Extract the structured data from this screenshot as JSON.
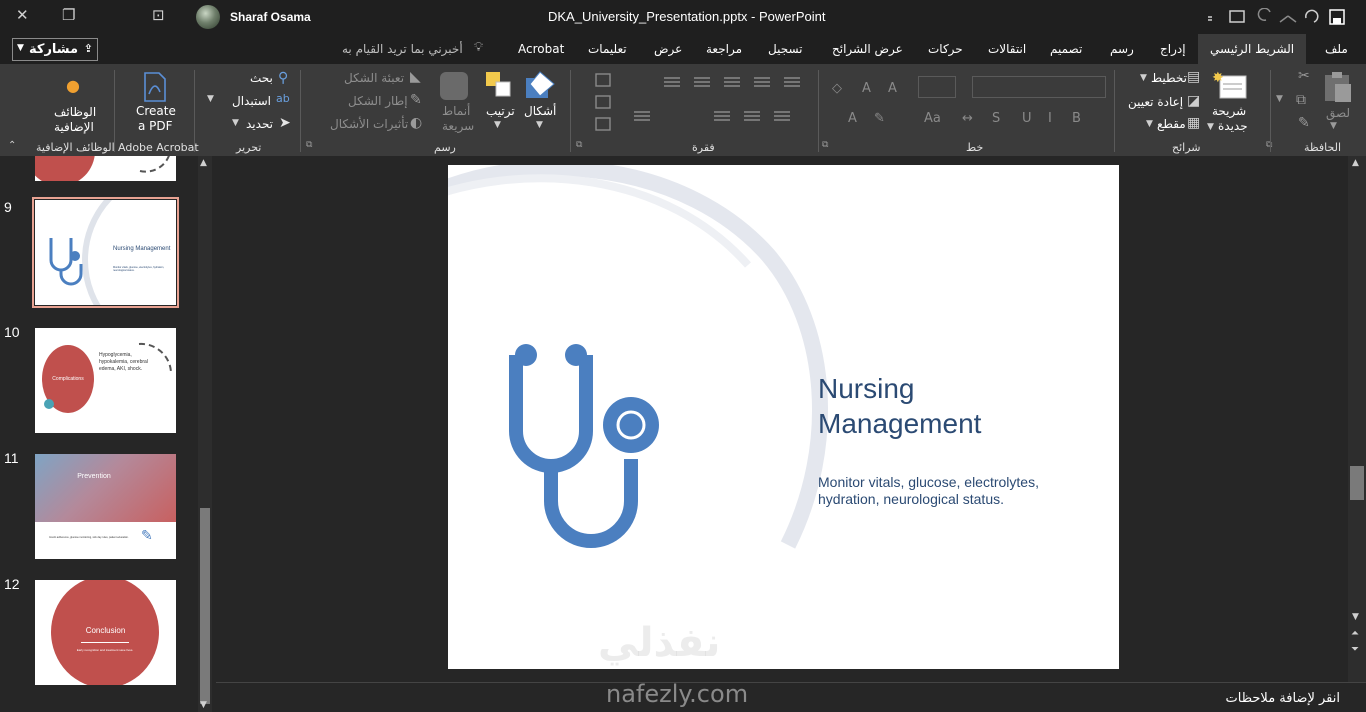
{
  "window": {
    "close_glyph": "✕",
    "restore_glyph": "❐",
    "ribbon_display_glyph": "⊡",
    "user_name": "Sharaf Osama",
    "doc_title": "DKA_University_Presentation.pptx  -  PowerPoint"
  },
  "header": {
    "share_label": "مشاركة",
    "tell_me": "أخبرني بما تريد القيام به",
    "tabs": [
      "ملف",
      "الشريط الرئيسي",
      "إدراج",
      "رسم",
      "تصميم",
      "انتقالات",
      "حركات",
      "عرض الشرائح",
      "تسجيل",
      "مراجعة",
      "عرض",
      "تعليمات",
      "Acrobat"
    ],
    "active_tab": "الشريط الرئيسي"
  },
  "ribbon": {
    "groups": {
      "addins": "الوظائف الإضافية",
      "acrobat": "Adobe Acrobat",
      "editing": "تحرير",
      "drawing": "رسم",
      "paragraph": "فقرة",
      "font": "خط",
      "slides": "شرائح",
      "clipboard": "الحافظة"
    },
    "addins_btn_1": "الوظائف",
    "addins_btn_2": "الإضافية",
    "create_pdf_1": "Create",
    "create_pdf_2": "a PDF",
    "find": "بحث",
    "replace": "استبدال",
    "select": "تحديد",
    "shape_fill": "تعبئة الشكل",
    "shape_outline": "إطار الشكل",
    "shape_effects": "تأثيرات الأشكال",
    "quick_styles_1": "أنماط",
    "quick_styles_2": "سريعة",
    "arrange": "ترتيب",
    "shapes": "أشكال",
    "layout": "تخطيط",
    "reset": "إعادة تعيين",
    "section": "مقطع",
    "new_slide_1": "شريحة",
    "new_slide_2": "جديدة",
    "paste": "لصق"
  },
  "thumbnails": [
    {
      "num": "9",
      "title": "Nursing Management",
      "text": "Monitor vitals, glucose, electrolytes, hydration, neurological status."
    },
    {
      "num": "10",
      "title": "Complications",
      "text": "Hypoglycemia, hypokalemia, cerebral edema, AKI, shock."
    },
    {
      "num": "11",
      "title": "Prevention",
      "text": "Insulin adherence, glucose monitoring, sick day rules, patient education."
    },
    {
      "num": "12",
      "title": "Conclusion",
      "text": "Early recognition and treatment save lives."
    }
  ],
  "slide": {
    "title": "Nursing Management",
    "body": "Monitor vitals, glucose, electrolytes, hydration, neurological status."
  },
  "notes": {
    "placeholder": "انقر لإضافة ملاحظات"
  },
  "watermark": {
    "arabic": "نفذلي",
    "latin": "nafezly.com"
  },
  "colors": {
    "accent": "#2b4a73",
    "stethoscope": "#4b7fc0",
    "thumb_red": "#c0504d",
    "selection": "#e8a292"
  }
}
